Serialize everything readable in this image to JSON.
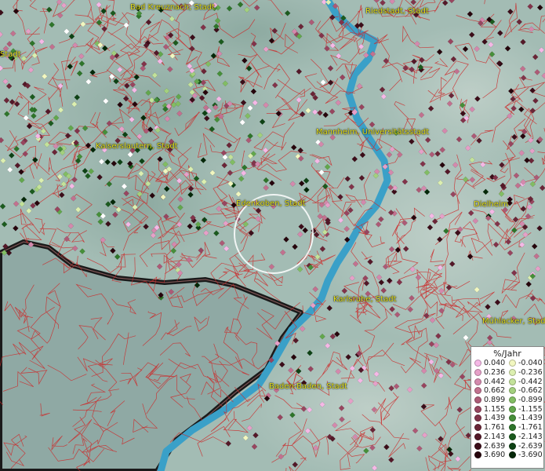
{
  "map": {
    "cities": [
      {
        "name": "Bad Kreuznach, Stadt"
      },
      {
        "name": "Riedstadt, Stadt"
      },
      {
        "name": "Stadt"
      },
      {
        "name": "Kaiserslautern, Stadt"
      },
      {
        "name": "Mannheim, Universitätsstadt"
      },
      {
        "name": "Edenkoben, Stadt"
      },
      {
        "name": "Dielheim"
      },
      {
        "name": "Karlsruhe, Stadt"
      },
      {
        "name": "Mühlacker, Stadt"
      },
      {
        "name": "Baden-Baden, Stadt"
      }
    ],
    "colors": {
      "land": "#a3bcb4",
      "water": "#3aa0c8",
      "boundary": "#cc2b2b",
      "border": "#111111",
      "city_label": "#e6e21c"
    }
  },
  "legend": {
    "title": "%/Jahr",
    "positive": [
      {
        "value": "0.040",
        "color": "#f5b8e6"
      },
      {
        "value": "0.236",
        "color": "#e6a0c8"
      },
      {
        "value": "0.442",
        "color": "#d489ad"
      },
      {
        "value": "0.662",
        "color": "#c2718f"
      },
      {
        "value": "0.899",
        "color": "#ad5a76"
      },
      {
        "value": "1.155",
        "color": "#98455f"
      },
      {
        "value": "1.439",
        "color": "#82334a"
      },
      {
        "value": "1.761",
        "color": "#6b2537"
      },
      {
        "value": "2.143",
        "color": "#541828"
      },
      {
        "value": "2.639",
        "color": "#3c0d19"
      },
      {
        "value": "3.690",
        "color": "#26050c"
      }
    ],
    "negative": [
      {
        "value": "-0.040",
        "color": "#f2f7c0"
      },
      {
        "value": "-0.236",
        "color": "#dcefb0"
      },
      {
        "value": "-0.442",
        "color": "#c3e29a"
      },
      {
        "value": "-0.662",
        "color": "#a3d07e"
      },
      {
        "value": "-0.899",
        "color": "#82bd63"
      },
      {
        "value": "-1.155",
        "color": "#62a74c"
      },
      {
        "value": "-1.439",
        "color": "#468f39"
      },
      {
        "value": "-1.761",
        "color": "#2e752a"
      },
      {
        "value": "-2.143",
        "color": "#1b5b1e"
      },
      {
        "value": "-2.639",
        "color": "#0d4214"
      },
      {
        "value": "-3.690",
        "color": "#042808"
      }
    ]
  }
}
